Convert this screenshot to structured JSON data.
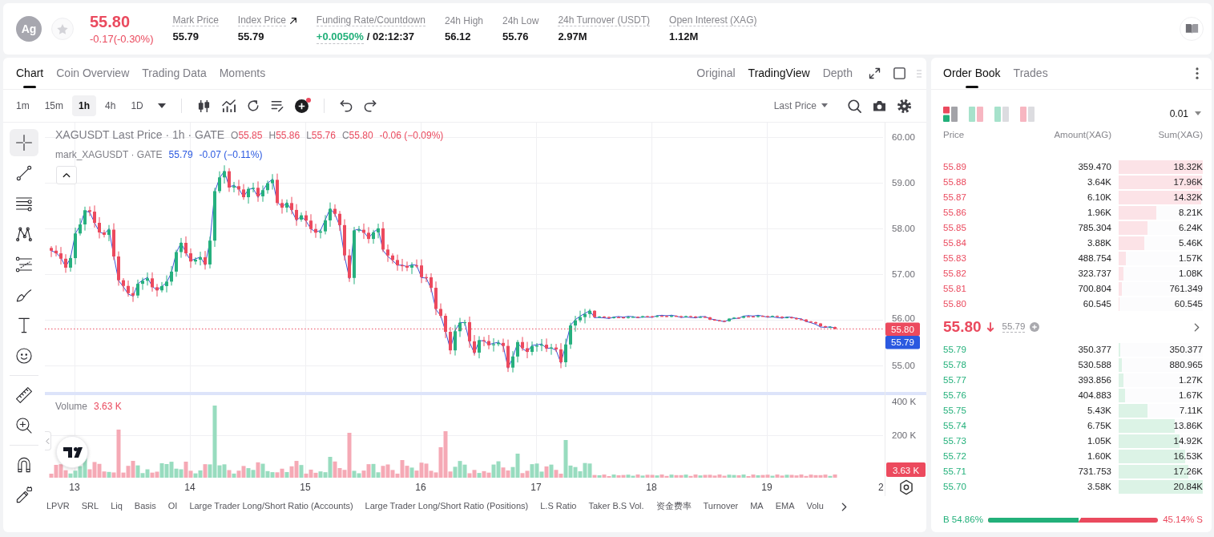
{
  "header": {
    "avatar": "Ag",
    "price": "55.80",
    "change": "-0.17(-0.30%)",
    "stats": [
      {
        "kind": "plain",
        "label": "Mark Price",
        "value": "55.79",
        "tooltip": true
      },
      {
        "kind": "link",
        "label": "Index Price",
        "value": "55.79",
        "tooltip": true
      },
      {
        "kind": "funding",
        "label": "Funding Rate/Countdown",
        "value": "+0.0050%",
        "countdown": "/ 02:12:37",
        "tooltip": true
      },
      {
        "kind": "plain",
        "label": "24h High",
        "value": "56.12",
        "tooltip": false
      },
      {
        "kind": "plain",
        "label": "24h Low",
        "value": "55.76",
        "tooltip": false
      },
      {
        "kind": "plain",
        "label": "24h Turnover (USDT)",
        "value": "2.97M",
        "tooltip": true
      },
      {
        "kind": "plain",
        "label": "Open Interest (XAG)",
        "value": "1.12M",
        "tooltip": true
      }
    ]
  },
  "chart_panel": {
    "tabs": [
      {
        "label": "Chart",
        "selected": true
      },
      {
        "label": "Coin Overview",
        "selected": false
      },
      {
        "label": "Trading Data",
        "selected": false
      },
      {
        "label": "Moments",
        "selected": false
      }
    ],
    "views": [
      {
        "label": "Original",
        "selected": false
      },
      {
        "label": "TradingView",
        "selected": true
      },
      {
        "label": "Depth",
        "selected": false
      }
    ],
    "intervals": [
      {
        "label": "1m",
        "selected": false
      },
      {
        "label": "15m",
        "selected": false
      },
      {
        "label": "1h",
        "selected": true
      },
      {
        "label": "4h",
        "selected": false
      },
      {
        "label": "1D",
        "selected": false
      }
    ],
    "price_source": "Last Price",
    "drawing_tools": [
      {
        "kind": "crosshair",
        "selected": true
      },
      {
        "kind": "trend-line",
        "selected": false
      },
      {
        "kind": "parallel-lines",
        "selected": false
      },
      {
        "kind": "pattern",
        "selected": false
      },
      {
        "kind": "levels",
        "selected": false
      },
      {
        "kind": "brush",
        "selected": false
      },
      {
        "kind": "text",
        "selected": false
      },
      {
        "kind": "emoji",
        "selected": false
      },
      {
        "kind": "ruler",
        "selected": false
      },
      {
        "kind": "zoom",
        "selected": false
      },
      {
        "kind": "magnet",
        "selected": false
      },
      {
        "kind": "pencil",
        "selected": false
      }
    ],
    "legend": {
      "title": "XAGUSDT Last Price · 1h · GATE",
      "ohlc": [
        {
          "key": "O",
          "value": "55.85"
        },
        {
          "key": "H",
          "value": "55.86"
        },
        {
          "key": "L",
          "value": "55.76"
        },
        {
          "key": "C",
          "value": "55.80"
        }
      ],
      "change": "-0.06 (−0.09%)"
    },
    "mark_legend": {
      "title": "mark_XAGUSDT · GATE",
      "value": "55.79",
      "change": "-0.07 (−0.11%)"
    },
    "volume_legend": {
      "label": "Volume",
      "value": "3.63 K"
    },
    "price_axis": [
      "60.00",
      "59.00",
      "58.00",
      "57.00",
      "56.00",
      "55.00"
    ],
    "price_tags": [
      {
        "kind": "last",
        "text": "55.80"
      },
      {
        "kind": "mark",
        "text": "55.79"
      }
    ],
    "volume_axis": [
      "400 K",
      "200 K"
    ],
    "volume_tag": "3.63 K",
    "time_axis": [
      "13",
      "14",
      "15",
      "16",
      "17",
      "18",
      "19",
      "2"
    ],
    "indicators": [
      "LPVR",
      "SRL",
      "Liq",
      "Basis",
      "OI",
      "Large Trader Long/Short Ratio (Accounts)",
      "Large Trader Long/Short Ratio (Positions)",
      "L.S Ratio",
      "Taker B.S Vol.",
      "资金费率",
      "Turnover",
      "MA",
      "EMA",
      "Volu"
    ]
  },
  "order_book": {
    "tabs": [
      {
        "label": "Order Book",
        "selected": true
      },
      {
        "label": "Trades",
        "selected": false
      }
    ],
    "layouts": [
      {
        "kind": "both",
        "selected": true
      },
      {
        "kind": "split",
        "selected": false
      },
      {
        "kind": "bids",
        "selected": false
      },
      {
        "kind": "asks",
        "selected": false
      }
    ],
    "precision": "0.01",
    "columns": [
      "Price",
      "Amount(XAG)",
      "Sum(XAG)"
    ],
    "asks": [
      {
        "price": "55.89",
        "amount": "359.470",
        "sum": "18.32K",
        "level": 1
      },
      {
        "price": "55.88",
        "amount": "3.64K",
        "sum": "17.96K",
        "level": 0.99
      },
      {
        "price": "55.87",
        "amount": "6.10K",
        "sum": "14.32K",
        "level": 0.98
      },
      {
        "price": "55.86",
        "amount": "1.96K",
        "sum": "8.21K",
        "level": 0.45
      },
      {
        "price": "55.85",
        "amount": "785.304",
        "sum": "6.24K",
        "level": 0.34
      },
      {
        "price": "55.84",
        "amount": "3.88K",
        "sum": "5.46K",
        "level": 0.3
      },
      {
        "price": "55.83",
        "amount": "488.754",
        "sum": "1.57K",
        "level": 0.09
      },
      {
        "price": "55.82",
        "amount": "323.737",
        "sum": "1.08K",
        "level": 0.06
      },
      {
        "price": "55.81",
        "amount": "700.804",
        "sum": "761.349",
        "level": 0.04
      },
      {
        "price": "55.80",
        "amount": "60.545",
        "sum": "60.545",
        "level": 0.01
      }
    ],
    "last_price": "55.80",
    "price_falling": true,
    "mark_price": "55.79",
    "bids": [
      {
        "price": "55.79",
        "amount": "350.377",
        "sum": "350.377",
        "level": 0.02
      },
      {
        "price": "55.78",
        "amount": "530.588",
        "sum": "880.965",
        "level": 0.04
      },
      {
        "price": "55.77",
        "amount": "393.856",
        "sum": "1.27K",
        "level": 0.06
      },
      {
        "price": "55.76",
        "amount": "404.883",
        "sum": "1.67K",
        "level": 0.08
      },
      {
        "price": "55.75",
        "amount": "5.43K",
        "sum": "7.11K",
        "level": 0.34
      },
      {
        "price": "55.74",
        "amount": "6.75K",
        "sum": "13.86K",
        "level": 0.67
      },
      {
        "price": "55.73",
        "amount": "1.05K",
        "sum": "14.92K",
        "level": 0.72
      },
      {
        "price": "55.72",
        "amount": "1.60K",
        "sum": "16.53K",
        "level": 0.79
      },
      {
        "price": "55.71",
        "amount": "731.753",
        "sum": "17.26K",
        "level": 0.83
      },
      {
        "price": "55.70",
        "amount": "3.58K",
        "sum": "20.84K",
        "level": 1
      }
    ],
    "ratio": {
      "buy": "B 54.86%",
      "sell": "45.14% S",
      "level": 0.5486
    }
  }
}
